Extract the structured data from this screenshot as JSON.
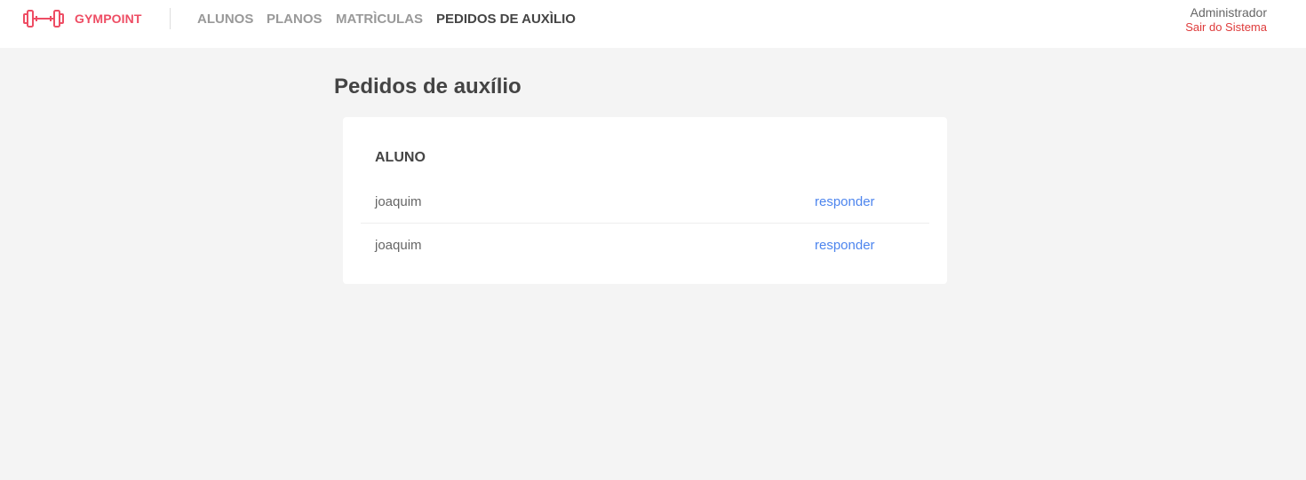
{
  "header": {
    "brand": "GYMPOINT",
    "nav": [
      {
        "label": "ALUNOS"
      },
      {
        "label": "PLANOS"
      },
      {
        "label": "MATRÌCULAS"
      },
      {
        "label": "PEDIDOS DE AUXÌLIO",
        "active": true
      }
    ],
    "user": {
      "name": "Administrador",
      "logout": "Sair do Sistema"
    },
    "icons": {
      "logo": "dumbbell-icon"
    }
  },
  "main": {
    "title": "Pedidos de auxílio",
    "table": {
      "columns": [
        "ALUNO"
      ],
      "rows": [
        {
          "name": "joaquim",
          "action": "responder"
        },
        {
          "name": "joaquim",
          "action": "responder"
        }
      ]
    }
  },
  "colors": {
    "brand": "#ee4d64",
    "logout": "#de3b3b",
    "link": "#4d85ee",
    "background": "#f4f4f4"
  }
}
